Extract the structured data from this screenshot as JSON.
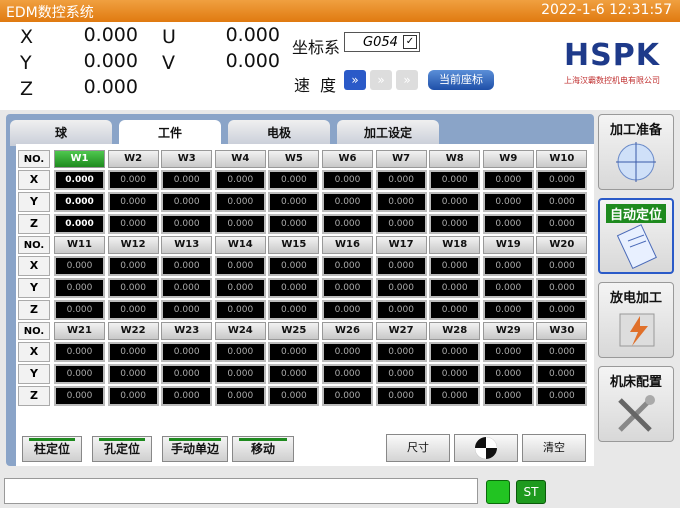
{
  "window": {
    "title": "EDM数控系统",
    "datetime": "2022-1-6 12:31:57"
  },
  "coords": {
    "x_label": "X",
    "y_label": "Y",
    "z_label": "Z",
    "u_label": "U",
    "v_label": "V",
    "x": "0.000",
    "y": "0.000",
    "z": "0.000",
    "u": "0.000",
    "v": "0.000"
  },
  "coord_system": {
    "label": "坐标系",
    "value": "G054"
  },
  "speed": {
    "label": "速度",
    "level_glyph": "»",
    "current_button": "当前座标"
  },
  "logo": {
    "text": "HSPK",
    "subtitle": "上海汉霸数控机电有限公司"
  },
  "tabs": [
    "球",
    "工件",
    "电极",
    "加工设定"
  ],
  "grid": {
    "row_head": "NO.",
    "axes": [
      "X",
      "Y",
      "Z"
    ],
    "blocks": [
      {
        "cols": [
          "W1",
          "W2",
          "W3",
          "W4",
          "W5",
          "W6",
          "W7",
          "W8",
          "W9",
          "W10"
        ]
      },
      {
        "cols": [
          "W11",
          "W12",
          "W13",
          "W14",
          "W15",
          "W16",
          "W17",
          "W18",
          "W19",
          "W20"
        ]
      },
      {
        "cols": [
          "W21",
          "W22",
          "W23",
          "W24",
          "W25",
          "W26",
          "W27",
          "W28",
          "W29",
          "W30"
        ]
      }
    ],
    "cell_value": "0.000",
    "selected": "W1"
  },
  "bottom_buttons": [
    "柱定位",
    "孔定位",
    "手动单边",
    "移动"
  ],
  "right_buttons": {
    "size": "尺寸",
    "clear": "清空"
  },
  "side_menu": [
    "加工准备",
    "自动定位",
    "放电加工",
    "机床配置"
  ],
  "status": {
    "st": "ST"
  },
  "colors": {
    "title_bar": "#e07a10",
    "accent_green": "#1e8a1e",
    "panel_blue": "#8aa4c8"
  }
}
